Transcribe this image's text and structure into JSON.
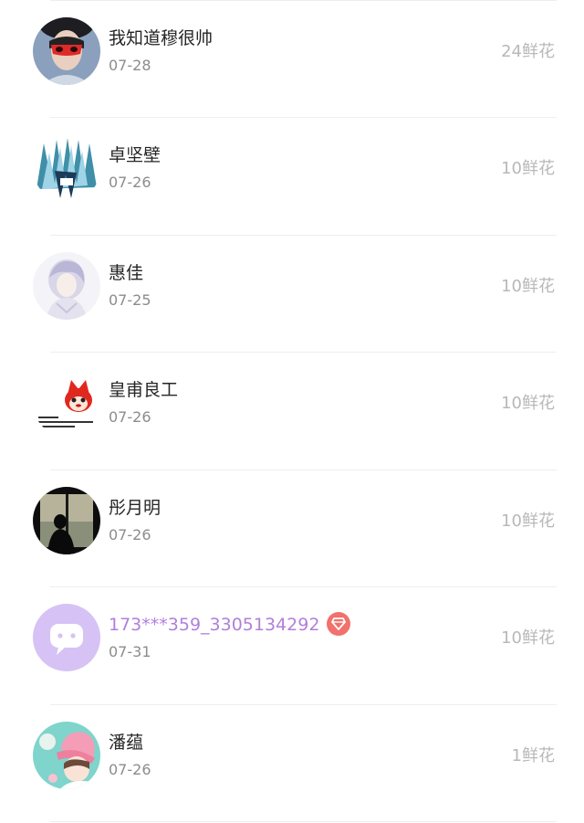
{
  "list": {
    "items": [
      {
        "name": "我知道穆很帅",
        "date": "07-28",
        "flowers": "24鲜花",
        "avatar_icon": "masked-boy-avatar-icon",
        "vip": false
      },
      {
        "name": "卓坚壁",
        "date": "07-26",
        "flowers": "10鲜花",
        "avatar_icon": "blue-hair-anime-avatar-icon",
        "vip": false
      },
      {
        "name": "惠佳",
        "date": "07-25",
        "flowers": "10鲜花",
        "avatar_icon": "white-hair-anime-avatar-icon",
        "vip": false
      },
      {
        "name": "皇甫良工",
        "date": "07-26",
        "flowers": "10鲜花",
        "avatar_icon": "red-fox-cartoon-avatar-icon",
        "vip": false
      },
      {
        "name": "彤月明",
        "date": "07-26",
        "flowers": "10鲜花",
        "avatar_icon": "silhouette-window-avatar-icon",
        "vip": false
      },
      {
        "name": "173***359_3305134292",
        "date": "07-31",
        "flowers": "10鲜花",
        "avatar_icon": "default-chat-bubble-avatar-icon",
        "vip": true
      },
      {
        "name": "潘蕴",
        "date": "07-26",
        "flowers": "1鲜花",
        "avatar_icon": "pink-hat-girl-avatar-icon",
        "vip": false
      }
    ]
  },
  "colors": {
    "vip_name": "#b07fdc",
    "vip_badge": "#f1716c",
    "flowers_text": "#b8b8b8",
    "date_text": "#8c8c8c",
    "default_avatar_bg": "#d6c2f5"
  }
}
